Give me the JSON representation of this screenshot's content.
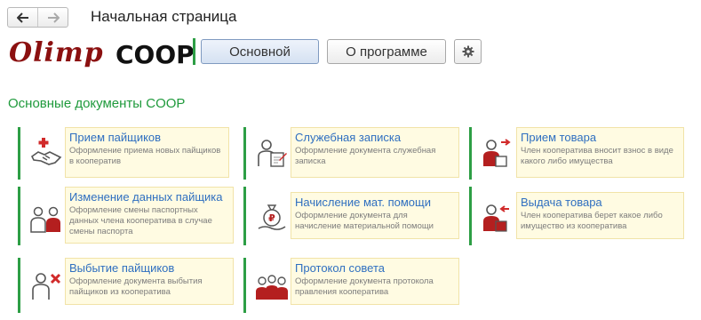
{
  "nav": {
    "back_icon": "arrow-left-icon",
    "forward_icon": "arrow-right-icon"
  },
  "page_title": "Начальная страница",
  "logo": {
    "script": "Olimp",
    "coop": "COOP"
  },
  "toolbar": {
    "main_label": "Основной",
    "about_label": "О программе",
    "settings_icon": "gear-icon"
  },
  "section_title": "Основные документы COOP",
  "colors": {
    "accent_green": "#2d9e45",
    "link_blue": "#2f6fc0",
    "card_bg": "#fffbe2",
    "logo_red": "#8b1010"
  },
  "cards": [
    {
      "title": "Прием пайщиков",
      "desc": "Оформление приема новых пайщиков в кооператив",
      "icon": "handshake-plus-icon"
    },
    {
      "title": "Служебная записка",
      "desc": "Оформление документа служебная записка",
      "icon": "person-memo-icon"
    },
    {
      "title": "Прием товара",
      "desc": "Член кооператива вносит взнос в виде какого либо имущества",
      "icon": "person-receive-goods-icon"
    },
    {
      "title": "Изменение данных пайщика",
      "desc": "Оформление смены паспортных данных члена кооператива в случае смены паспорта",
      "icon": "people-exchange-icon"
    },
    {
      "title": "Начисление мат. помощи",
      "desc": "Оформление документа для начисление материальной помощи",
      "icon": "money-bag-hand-icon"
    },
    {
      "title": "Выдача товара",
      "desc": "Член кооператива берет какое либо имущество из кооператива",
      "icon": "person-give-goods-icon"
    },
    {
      "title": "Выбытие пайщиков",
      "desc": "Оформление документа выбытия пайщиков из кооператива",
      "icon": "person-remove-icon"
    },
    {
      "title": "Протокол совета",
      "desc": "Оформление документа протокола правления кооператива",
      "icon": "council-group-icon"
    }
  ]
}
